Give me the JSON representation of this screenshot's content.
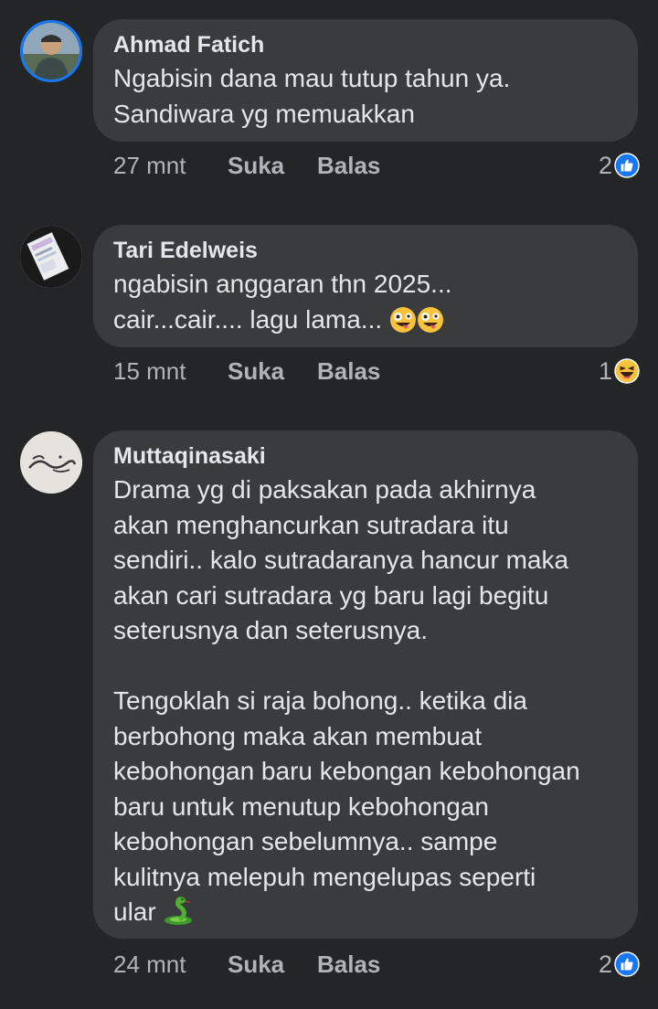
{
  "comments": [
    {
      "author": "Ahmad Fatich",
      "lines": [
        "Ngabisin dana mau tutup tahun ya.",
        "Sandiwara yg memuakkan"
      ],
      "time": "27 mnt",
      "like_label": "Suka",
      "reply_label": "Balas",
      "reaction_count": "2",
      "reaction_icon": "like-icon",
      "avatar_ring_color": "#1877f2"
    },
    {
      "author": "Tari Edelweis",
      "lines": [
        "ngabisin anggaran thn 2025...",
        "cair...cair.... lagu lama..."
      ],
      "emojis": [
        "zany-face-icon",
        "zany-face-icon"
      ],
      "time": "15 mnt",
      "like_label": "Suka",
      "reply_label": "Balas",
      "reaction_count": "1",
      "reaction_icon": "haha-icon"
    },
    {
      "author": "Muttaqinasaki",
      "lines": [
        "Drama yg di paksakan pada akhirnya",
        "akan menghancurkan sutradara itu",
        "sendiri.. kalo sutradaranya hancur maka",
        "akan cari sutradara yg baru lagi begitu",
        "seterusnya dan seterusnya.",
        "",
        "Tengoklah si raja bohong.. ketika dia",
        "berbohong maka akan membuat",
        "kebohongan baru kebongan kebohongan",
        "baru untuk menutup kebohongan",
        "kebohongan sebelumnya.. sampe",
        "kulitnya melepuh mengelupas seperti",
        "ular"
      ],
      "emojis": [
        "snake-icon"
      ],
      "time": "24 mnt",
      "like_label": "Suka",
      "reply_label": "Balas",
      "reaction_count": "2",
      "reaction_icon": "like-icon"
    }
  ],
  "colors": {
    "background": "#242526",
    "bubble": "#3a3b3c",
    "text": "#e4e6eb",
    "meta": "#b0b3b8",
    "like_blue": "#1877f2"
  }
}
